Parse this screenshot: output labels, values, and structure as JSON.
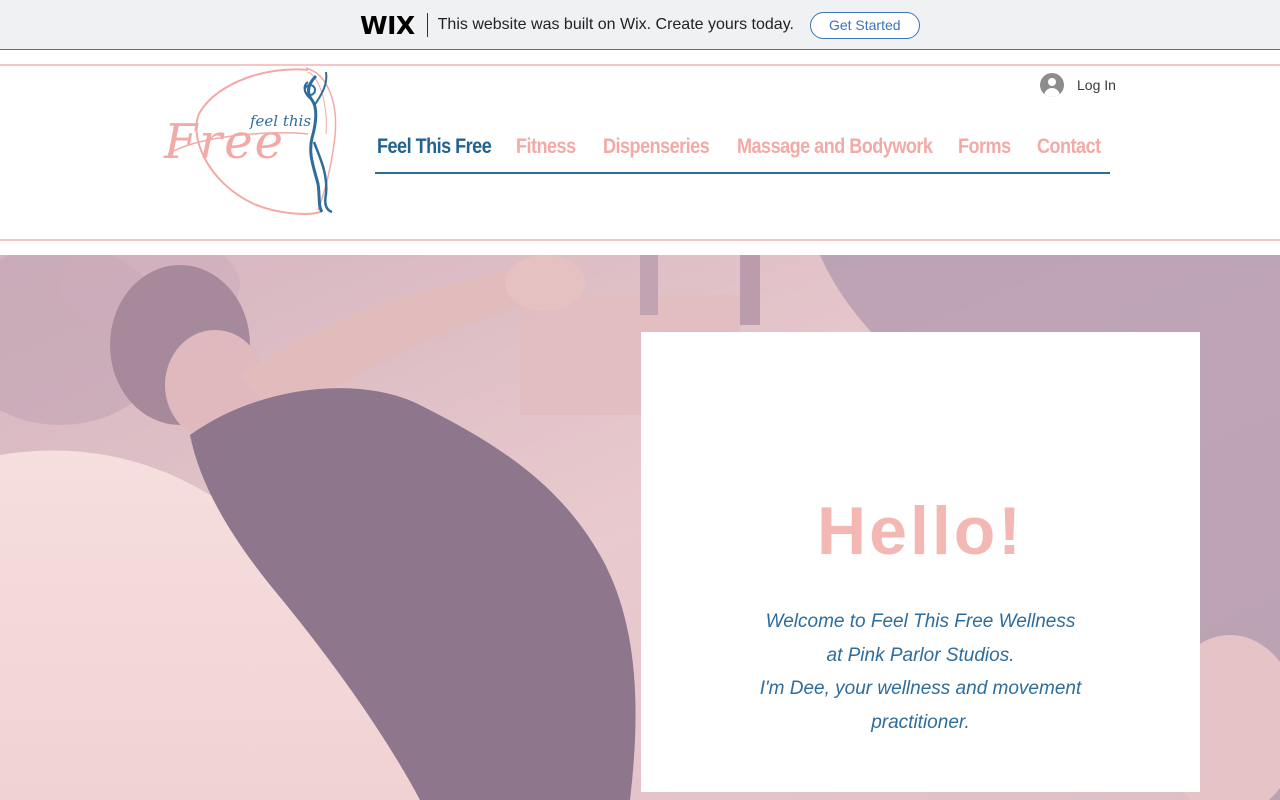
{
  "wix_banner": {
    "logo": "WIX",
    "text": "This website was built on Wix. Create yours today.",
    "button_label": "Get Started"
  },
  "header": {
    "logo_text_small": "feel this",
    "logo_text_large": "Free",
    "login_label": "Log In",
    "nav": [
      {
        "label": "Feel This Free",
        "active": true
      },
      {
        "label": "Fitness",
        "active": false
      },
      {
        "label": "Dispenseries",
        "active": false
      },
      {
        "label": "Massage and Bodywork",
        "active": false
      },
      {
        "label": "Forms",
        "active": false
      },
      {
        "label": "Contact",
        "active": false
      }
    ]
  },
  "hero": {
    "image": "woman-stretching-photo",
    "heading": "Hello!",
    "welcome_lines": [
      "Welcome to Feel This Free Wellness",
      "at Pink Parlor Studios.",
      "I'm Dee, your wellness and movement",
      "practitioner."
    ]
  },
  "colors": {
    "nav_active": "#23638f",
    "nav_inactive": "#f2aaa6",
    "accent_pink": "#f4b8b4",
    "accent_blue": "#2e6d9b",
    "wix_blue": "#3d73b8"
  }
}
